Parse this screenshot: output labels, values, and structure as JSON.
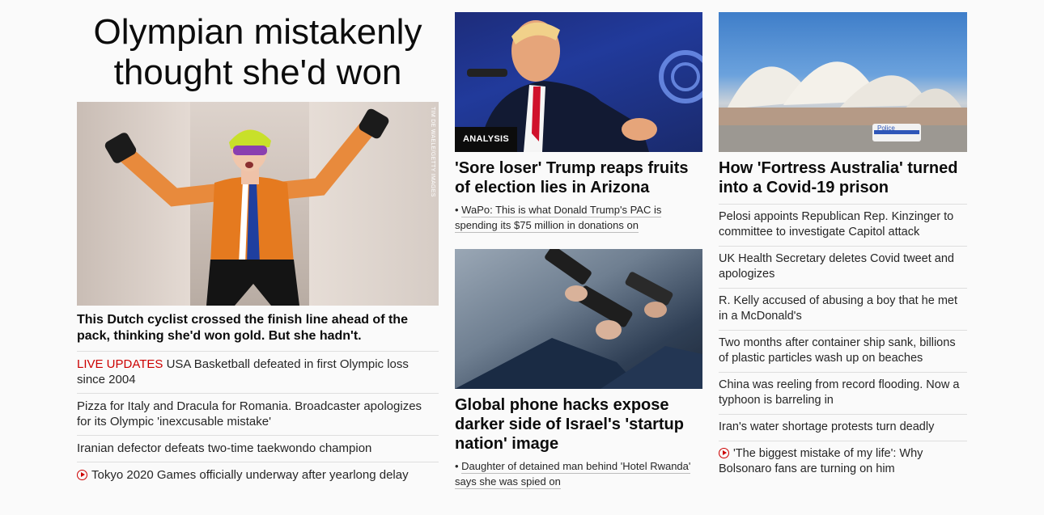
{
  "lead": {
    "headline": "Olympian mistakenly thought she'd won",
    "image_credit": "TIM DE WAELE/GETTY IMAGES",
    "subhead": "This Dutch cyclist crossed the finish line ahead of the pack, thinking she'd won gold. But she hadn't.",
    "items": [
      {
        "prefix": "LIVE UPDATES",
        "text": "USA Basketball defeated in first Olympic loss since 2004"
      },
      {
        "text": "Pizza for Italy and Dracula for Romania. Broadcaster apologizes for its Olympic 'inexcusable mistake'"
      },
      {
        "text": "Iranian defector defeats two-time taekwondo champion"
      },
      {
        "icon": "play-icon",
        "text": "Tokyo 2020 Games officially underway after yearlong delay"
      }
    ]
  },
  "middle": {
    "card1": {
      "tag": "ANALYSIS",
      "title": "'Sore loser' Trump reaps fruits of election lies in Arizona",
      "bullet": "WaPo: This is what Donald Trump's PAC is spending its $75 million in donations on"
    },
    "card2": {
      "title": "Global phone hacks expose darker side of Israel's 'startup nation' image",
      "bullet": "Daughter of detained man behind 'Hotel Rwanda' says she was spied on"
    }
  },
  "right": {
    "title": "How 'Fortress Australia' turned into a Covid-19 prison",
    "image_sign": "Police",
    "items": [
      {
        "text": "Pelosi appoints Republican Rep. Kinzinger to committee to investigate Capitol attack"
      },
      {
        "text": "UK Health Secretary deletes Covid tweet and apologizes"
      },
      {
        "text": "R. Kelly accused of abusing a boy that he met in a McDonald's"
      },
      {
        "text": "Two months after container ship sank, billions of plastic particles wash up on beaches"
      },
      {
        "text": "China was reeling from record flooding. Now a typhoon is barreling in"
      },
      {
        "text": "Iran's water shortage protests turn deadly"
      },
      {
        "icon": "play-icon",
        "text": "'The biggest mistake of my life': Why Bolsonaro fans are turning on him"
      }
    ]
  },
  "colors": {
    "live": "#cc0000",
    "text": "#262626",
    "headline": "#0c0c0c",
    "divider": "#dedede"
  }
}
